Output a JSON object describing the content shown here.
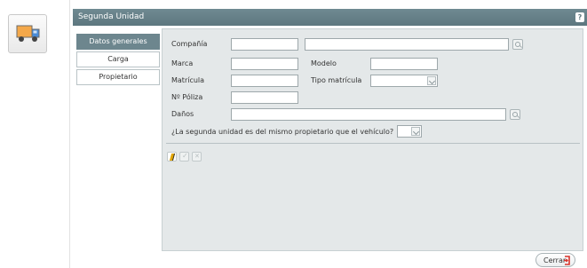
{
  "window": {
    "title": "Segunda Unidad",
    "help_label": "?"
  },
  "tabs": [
    {
      "label": "Datos generales"
    },
    {
      "label": "Carga"
    },
    {
      "label": "Propietario"
    }
  ],
  "form": {
    "compania_label": "Compañía",
    "compania_code": "",
    "compania_name": "",
    "marca_label": "Marca",
    "marca": "",
    "modelo_label": "Modelo",
    "modelo": "",
    "matricula_label": "Matrícula",
    "matricula": "",
    "tipo_matricula_label": "Tipo matrícula",
    "tipo_matricula": "",
    "poliza_label": "Nº Póliza",
    "poliza": "",
    "danos_label": "Daños",
    "danos": "",
    "mismo_propietario_label": "¿La segunda unidad es del mismo propietario que el vehículo?",
    "mismo_propietario": ""
  },
  "buttons": {
    "close_label": "Cerrar"
  },
  "colors": {
    "titlebar": "#5d777f",
    "active_tab": "#6d868e",
    "form_bg": "#e4e8e9",
    "edit_accent": "#e1a500",
    "exit_red": "#d8322a"
  }
}
